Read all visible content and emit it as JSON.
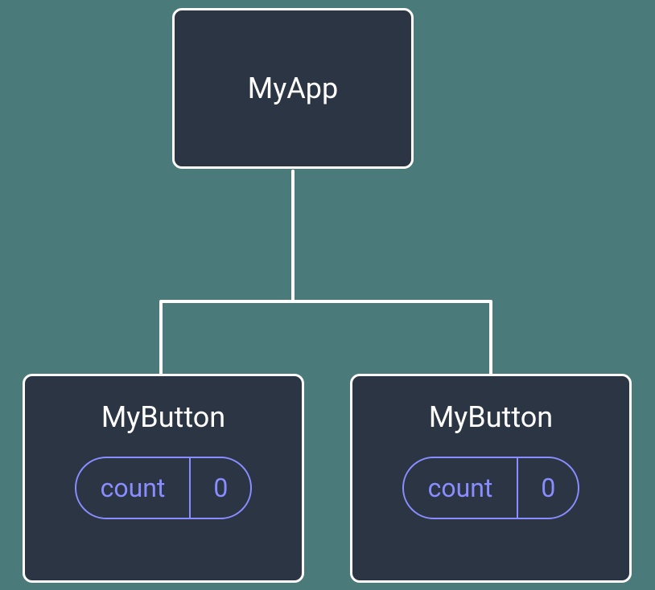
{
  "root": {
    "label": "MyApp"
  },
  "children": [
    {
      "label": "MyButton",
      "state_label": "count",
      "state_value": "0"
    },
    {
      "label": "MyButton",
      "state_label": "count",
      "state_value": "0"
    }
  ],
  "colors": {
    "background": "#4a7a7a",
    "node_fill": "#2b3544",
    "node_border": "#ffffff",
    "accent": "#8a8dff",
    "text": "#ffffff"
  }
}
